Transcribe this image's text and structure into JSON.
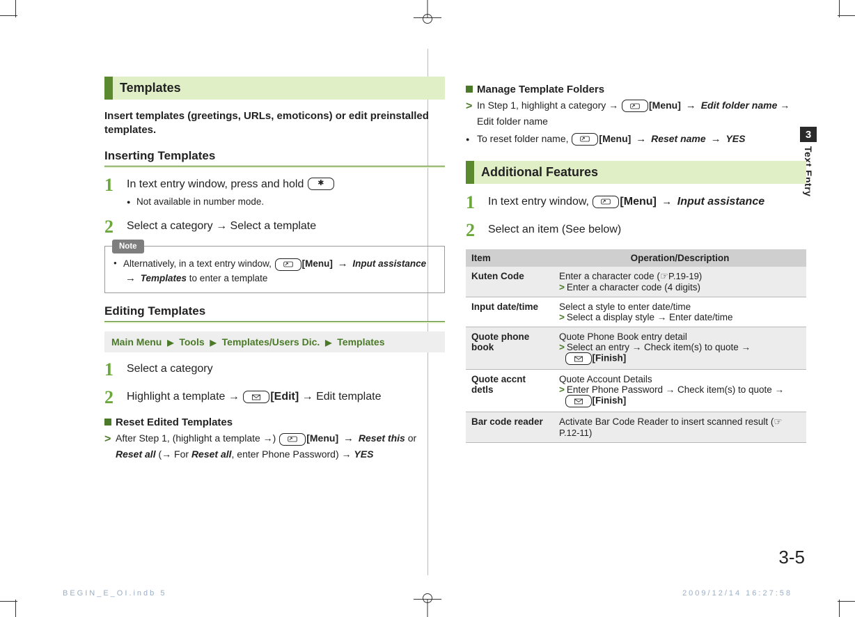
{
  "chapter": {
    "number": "3",
    "name": "Text Entry"
  },
  "pageNumber": "3-5",
  "footer": {
    "left": "BEGIN_E_OI.indb   5",
    "right": "2009/12/14   16:27:58"
  },
  "left": {
    "sectionTitle": "Templates",
    "intro": "Insert templates (greetings, URLs, emoticons) or edit preinstalled templates.",
    "sub1": "Inserting Templates",
    "step1": {
      "text": "In text entry window, press and hold ",
      "note": "Not available in number mode."
    },
    "step2": "Select a category → Select a template",
    "noteLabel": "Note",
    "noteText1": "Alternatively, in a text entry window, ",
    "noteMenu": "[Menu]",
    "noteArrow": "→",
    "noteInput": "Input assistance",
    "noteTemplates": "Templates",
    "noteTail": " to enter a template",
    "sub2": "Editing Templates",
    "menuPath": {
      "a": "Main Menu",
      "b": "Tools",
      "c": "Templates/Users Dic.",
      "d": "Templates"
    },
    "estep1": "Select a category",
    "estep2a": "Highlight a template → ",
    "estep2b": "[Edit]",
    "estep2c": " → Edit template",
    "reset": {
      "title": "Reset Edited Templates",
      "line1a": "After Step 1, (highlight a template →) ",
      "menu": "[Menu]",
      "resetThis": "Reset this",
      "or": " or ",
      "resetAll": "Reset all",
      "paren": " (→ For ",
      "resetAll2": "Reset all",
      "paren2": ", enter Phone Password) → ",
      "yes": "YES"
    }
  },
  "right": {
    "manage": {
      "title": "Manage Template Folders",
      "l1a": "In Step 1, highlight a category → ",
      "menu": "[Menu]",
      "edit": "Edit folder name",
      "l1b": " → Edit folder name",
      "l2a": "To reset folder name, ",
      "reset": "Reset name",
      "yes": "YES"
    },
    "sectionTitle": "Additional Features",
    "step1a": "In text entry window, ",
    "step1menu": "[Menu]",
    "step1b": "Input assistance",
    "step2": "Select an item (See below)",
    "table": {
      "h1": "Item",
      "h2": "Operation/Description",
      "r1": {
        "name": "Kuten Code",
        "d1": "Enter a character code (",
        "ref": "P.19-19",
        "d2": ")",
        "g": "Enter a character code (4 digits)"
      },
      "r2": {
        "name": "Input date/time",
        "d1": "Select a style to enter date/time",
        "g": "Select a display style → Enter date/time"
      },
      "r3": {
        "name": "Quote phone book",
        "d1": "Quote Phone Book entry detail",
        "g": "Select an entry → Check item(s) to quote → ",
        "fin": "[Finish]"
      },
      "r4": {
        "name": "Quote accnt detls",
        "d1": "Quote Account Details",
        "g": "Enter Phone Password → Check item(s) to quote → ",
        "fin": "[Finish]"
      },
      "r5": {
        "name": "Bar code reader",
        "d1": "Activate Bar Code Reader to insert scanned result (",
        "ref": "P.12-11",
        "d2": ")"
      }
    }
  }
}
